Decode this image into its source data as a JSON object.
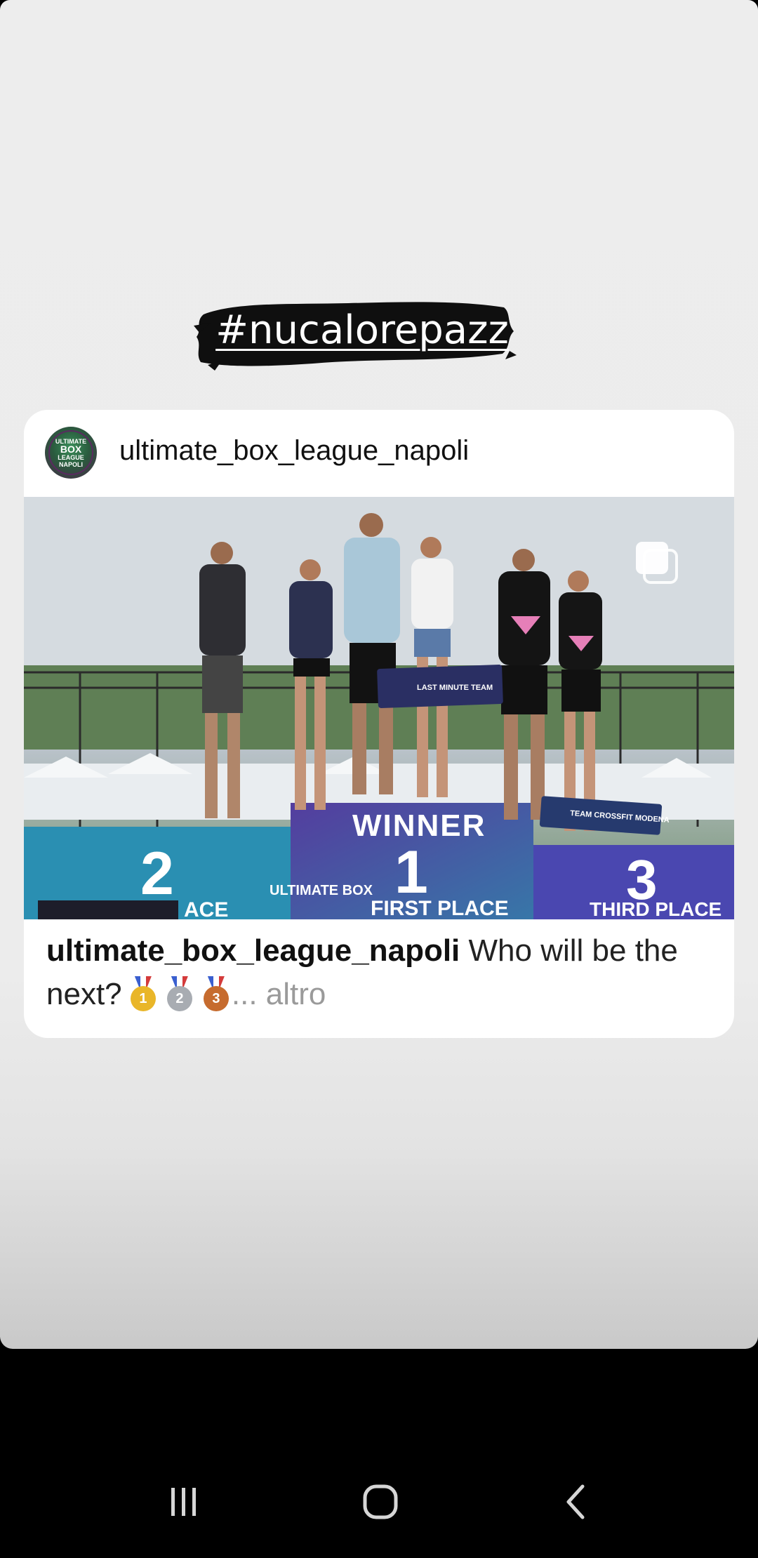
{
  "story": {
    "hashtag": "#nucalorepazz",
    "background_color": "#ececec"
  },
  "post": {
    "username": "ultimate_box_league_napoli",
    "avatar_text": [
      "ULTIMATE",
      "BOX",
      "LEAGUE",
      "NAPOLI"
    ],
    "multi_image_icon": "multiple-photos-icon",
    "photo_text": {
      "winner": "WINNER",
      "first_place_number": "1",
      "second_place_number": "2",
      "third_place_number": "3",
      "first_place": "FIRST PLACE",
      "third_place": "THIRD PLACE",
      "second_place_partial": "ACE",
      "sign_center": "LAST MINUTE TEAM",
      "sign_right": "TEAM CROSSFIT MODENA",
      "box_logo": "ULTIMATE BOX"
    },
    "caption": {
      "user": "ultimate_box_league_napoli",
      "text": "Who will be the next?",
      "medals": [
        "1",
        "2",
        "3"
      ],
      "more": "... altro"
    }
  },
  "navigation": {
    "recent_icon": "recent-apps-icon",
    "home_icon": "home-icon",
    "back_icon": "back-icon"
  },
  "colors": {
    "nav_bar": "#000000",
    "card": "#ffffff",
    "podium_blue": "#2a7fb8",
    "podium_purple": "#5a3fa0",
    "gold": "#e9b629",
    "silver": "#a8acb2",
    "bronze": "#c66b2e"
  }
}
